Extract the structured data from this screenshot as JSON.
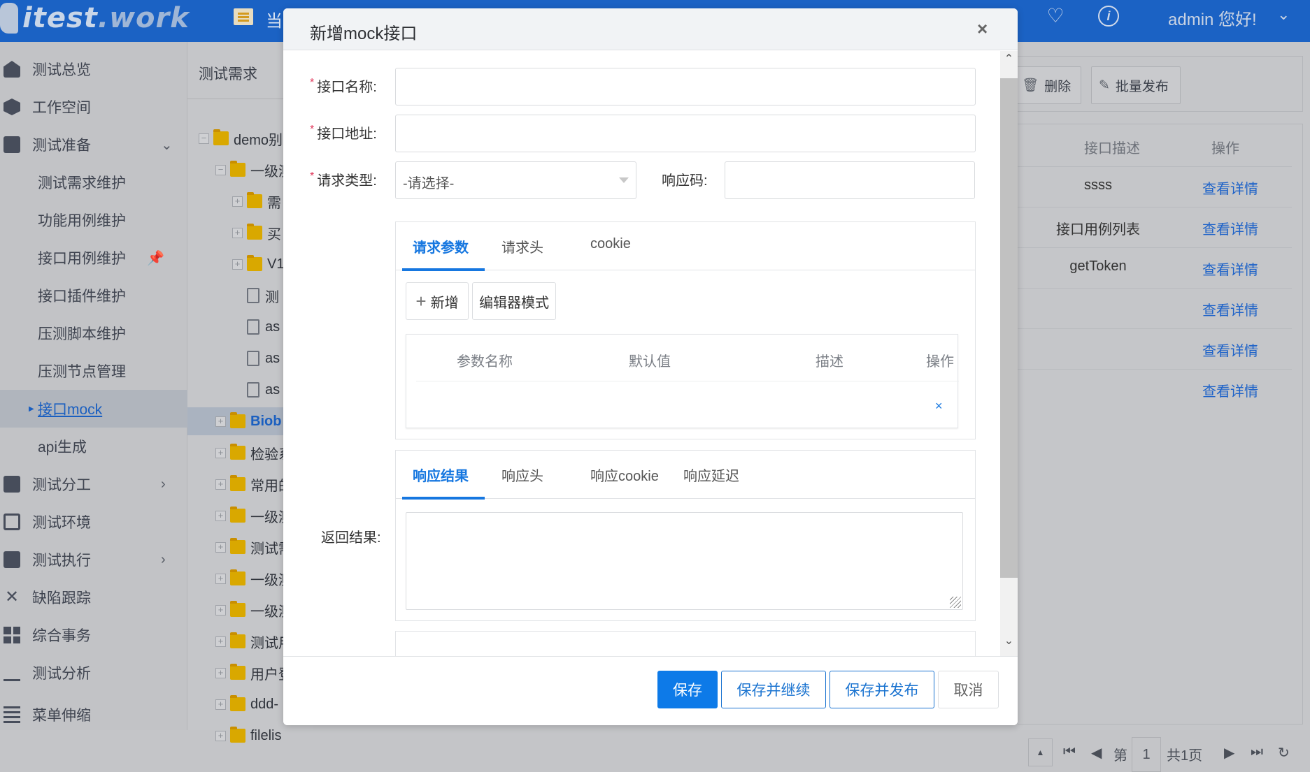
{
  "header": {
    "logo": "itest",
    "logo_suffix": ".work",
    "nav_text": "当",
    "user_greeting": "admin 您好!",
    "icons": [
      "heart-icon",
      "info-icon",
      "chevron-down-icon"
    ]
  },
  "sidebar": {
    "items": [
      {
        "label": "测试总览",
        "icon": "home-icon"
      },
      {
        "label": "工作空间",
        "icon": "workspace-icon"
      },
      {
        "label": "测试准备",
        "icon": "monitor-icon",
        "expanded": true
      },
      {
        "label": "测试需求维护"
      },
      {
        "label": "功能用例维护"
      },
      {
        "label": "接口用例维护",
        "pinned": true
      },
      {
        "label": "接口插件维护"
      },
      {
        "label": "压测脚本维护"
      },
      {
        "label": "压测节点管理"
      },
      {
        "label": "接口mock",
        "active": true
      },
      {
        "label": "api生成"
      },
      {
        "label": "测试分工",
        "icon": "task-icon",
        "has_children": true
      },
      {
        "label": "测试环境",
        "icon": "window-icon"
      },
      {
        "label": "测试执行",
        "icon": "clipboard-check-icon",
        "has_children": true
      },
      {
        "label": "缺陷跟踪",
        "icon": "tools-icon"
      },
      {
        "label": "综合事务",
        "icon": "grid-icon"
      },
      {
        "label": "测试分析",
        "icon": "bar-chart-icon"
      },
      {
        "label": "菜单伸缩",
        "icon": "collapse-menu-icon"
      }
    ]
  },
  "tree": {
    "title": "测试需求",
    "nodes": [
      {
        "label": "demo别",
        "type": "folder",
        "toggle": "−",
        "level": 0
      },
      {
        "label": "一级测",
        "type": "folder",
        "toggle": "−",
        "level": 1
      },
      {
        "label": "需",
        "type": "folder",
        "toggle": "+",
        "level": 2
      },
      {
        "label": "买",
        "type": "folder",
        "toggle": "+",
        "level": 2
      },
      {
        "label": "V1",
        "type": "folder",
        "toggle": "+",
        "level": 2
      },
      {
        "label": "测",
        "type": "doc",
        "level": 2
      },
      {
        "label": "as",
        "type": "doc",
        "level": 2
      },
      {
        "label": "as",
        "type": "doc",
        "level": 2
      },
      {
        "label": "as",
        "type": "doc",
        "level": 2
      },
      {
        "label": "Biob",
        "type": "folder",
        "toggle": "+",
        "level": 1,
        "selected": true
      },
      {
        "label": "检验系",
        "type": "folder",
        "toggle": "+",
        "level": 1
      },
      {
        "label": "常用的",
        "type": "folder",
        "toggle": "+",
        "level": 1
      },
      {
        "label": "一级测",
        "type": "folder",
        "toggle": "+",
        "level": 1
      },
      {
        "label": "测试需",
        "type": "folder",
        "toggle": "+",
        "level": 1
      },
      {
        "label": "一级测",
        "type": "folder",
        "toggle": "+",
        "level": 1
      },
      {
        "label": "一级测",
        "type": "folder",
        "toggle": "+",
        "level": 1
      },
      {
        "label": "测试用",
        "type": "folder",
        "toggle": "+",
        "level": 1
      },
      {
        "label": "用户登",
        "type": "folder",
        "toggle": "+",
        "level": 1
      },
      {
        "label": "ddd-",
        "type": "folder",
        "toggle": "+",
        "level": 1
      },
      {
        "label": "filelis",
        "type": "folder",
        "toggle": "+",
        "level": 1
      }
    ]
  },
  "background_table": {
    "toolbar": {
      "delete": "删除",
      "batch_publish": "批量发布"
    },
    "columns": [
      "接口描述",
      "操作"
    ],
    "rows": [
      {
        "desc": "ssss",
        "action": "查看详情"
      },
      {
        "desc": "接口用例列表",
        "action": "查看详情"
      },
      {
        "desc": "getToken",
        "action": "查看详情"
      },
      {
        "desc": "",
        "action": "查看详情"
      },
      {
        "desc": "",
        "action": "查看详情"
      },
      {
        "desc": "",
        "action": "查看详情"
      }
    ],
    "pagination": {
      "page_prefix": "第",
      "page": "1",
      "total": "共1页"
    }
  },
  "modal": {
    "title": "新增mock接口",
    "close": "×",
    "fields": {
      "name_label": "接口名称:",
      "name_value": "",
      "url_label": "接口地址:",
      "url_value": "",
      "method_label": "请求类型:",
      "method_selected": "-请选择-",
      "code_label": "响应码:",
      "code_value": "",
      "required_mark": "*"
    },
    "request_tabs": [
      "请求参数",
      "请求头",
      "cookie"
    ],
    "request_active_tab": 0,
    "add_button": "新增",
    "editor_mode_button": "编辑器模式",
    "param_columns": [
      "参数名称",
      "默认值",
      "描述",
      "操作"
    ],
    "param_row_delete": "×",
    "response_label": "返回结果:",
    "response_tabs": [
      "响应结果",
      "响应头",
      "响应cookie",
      "响应延迟"
    ],
    "response_active_tab": 0,
    "response_value": "",
    "footer": {
      "save": "保存",
      "save_continue": "保存并继续",
      "save_publish": "保存并发布",
      "cancel": "取消"
    }
  },
  "colors": {
    "header_bg": "#1b62c4",
    "primary": "#0d7ae8",
    "link": "#1f63c8",
    "required": "#e0365a",
    "folder": "#d9a800"
  }
}
